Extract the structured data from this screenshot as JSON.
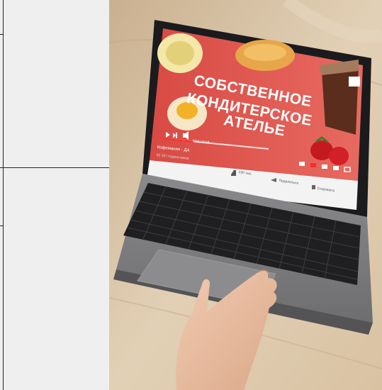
{
  "photo": {
    "subject": "laptop-with-video-player",
    "video": {
      "headline_lines": [
        "СОБСТВЕННОЕ",
        "КОНДИТЕРСКОЕ",
        "АТЕЛЬЕ"
      ],
      "time": "0:04 / 0:18",
      "channel": "Кофемания - ДА",
      "subscribers": "92 257 подписчиков",
      "likes": "230 тыс.",
      "share_label": "Поделиться",
      "save_label": "Сохранить"
    }
  },
  "colors": {
    "left_panel": "#efefef",
    "video_red": "#e0574f",
    "table": "#d8c3a6"
  }
}
